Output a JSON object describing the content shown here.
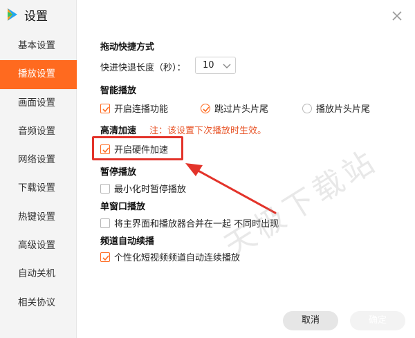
{
  "app": {
    "title": "设置"
  },
  "sidebar": {
    "items": [
      {
        "label": "基本设置",
        "active": false
      },
      {
        "label": "播放设置",
        "active": true
      },
      {
        "label": "画面设置",
        "active": false
      },
      {
        "label": "音频设置",
        "active": false
      },
      {
        "label": "网络设置",
        "active": false
      },
      {
        "label": "下载设置",
        "active": false
      },
      {
        "label": "热键设置",
        "active": false
      },
      {
        "label": "高级设置",
        "active": false
      },
      {
        "label": "自动关机",
        "active": false
      },
      {
        "label": "相关协议",
        "active": false
      }
    ]
  },
  "drag_shortcut": {
    "title": "拖动快捷方式",
    "step_label": "快进快退长度（秒）：",
    "step_value": "10"
  },
  "smart_play": {
    "title": "智能播放",
    "options": [
      {
        "label": "开启连播功能",
        "checked": true
      },
      {
        "label": "跳过片头片尾",
        "checked": true
      },
      {
        "label": "播放片头片尾",
        "checked": false
      }
    ]
  },
  "hd_accel": {
    "title": "高清加速",
    "note": "注：该设置下次播放时生效。",
    "option": {
      "label": "开启硬件加速",
      "checked": true
    }
  },
  "pause_play": {
    "title": "暂停播放",
    "option": {
      "label": "最小化时暂停播放",
      "checked": false
    }
  },
  "single_window": {
    "title": "单窗口播放",
    "option": {
      "label": "将主界面和播放器合并在一起 不同时出现",
      "checked": false
    }
  },
  "channel_autoplay": {
    "title": "频道自动续播",
    "option": {
      "label": "个性化短视频频道自动连续播放",
      "checked": true
    }
  },
  "footer": {
    "cancel": "取消",
    "ok": "确定"
  },
  "watermark": "天极下载站",
  "colors": {
    "accent": "#ff6a1f",
    "note": "#e8562a",
    "highlight": "#e3332a"
  }
}
